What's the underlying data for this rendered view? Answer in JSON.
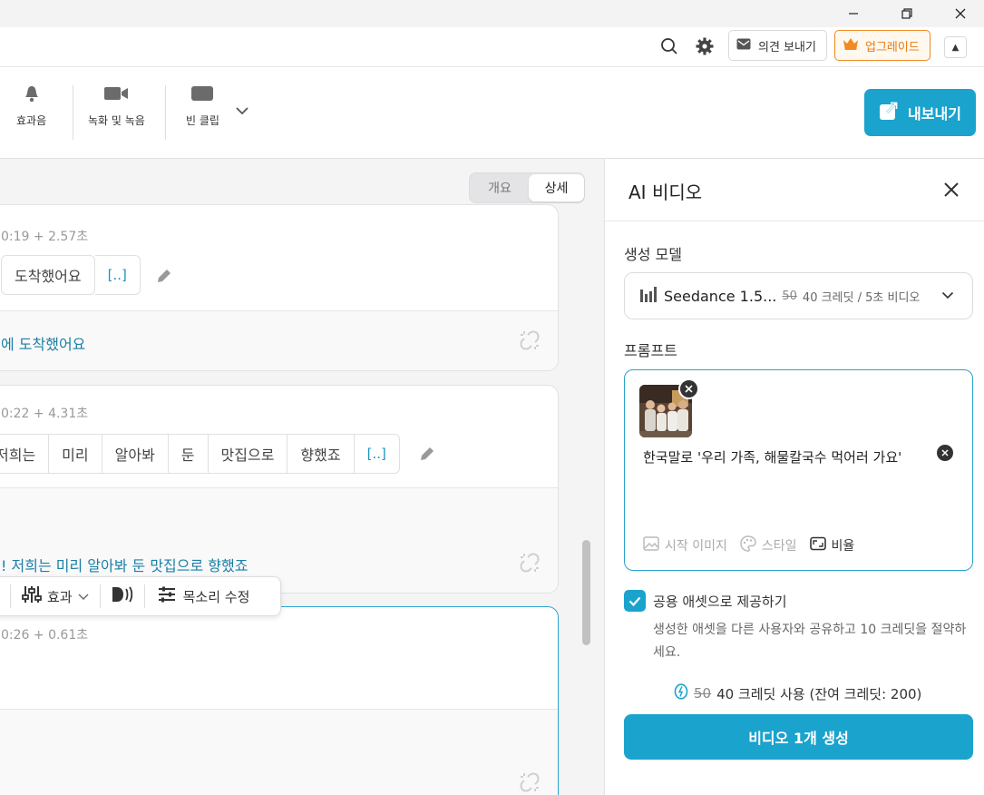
{
  "window": {
    "minimize": "—",
    "maximize": "❐",
    "close": "✕"
  },
  "header": {
    "feedback_label": "의견 보내기",
    "upgrade_label": "업그레이드"
  },
  "toolbar": {
    "tools": [
      {
        "label": "효과음",
        "icon": "bell-icon"
      },
      {
        "label": "녹화 및 녹음",
        "icon": "video-camera-icon"
      },
      {
        "label": "빈 클립",
        "icon": "blank-clip-icon"
      }
    ],
    "export_label": "내보내기"
  },
  "view_toggle": {
    "overview": "개요",
    "detail": "상세"
  },
  "cards": [
    {
      "time": "0:19 + 2.57초",
      "words": [
        "도착했어요"
      ],
      "more": "[..]",
      "subtitle": "에 도착했어요"
    },
    {
      "time": "0:22 + 4.31초",
      "words": [
        "저희는",
        "미리",
        "알아봐",
        "둔",
        "맛집으로",
        "향했죠"
      ],
      "more": "[..]",
      "subtitle": "! 저희는 미리 알아봐 둔 맛집으로 향했죠"
    },
    {
      "time": "0:26 + 0.61초"
    }
  ],
  "float_bar": {
    "effect_label": "효과",
    "voice_label": "목소리 수정"
  },
  "panel": {
    "title": "AI 비디오",
    "model_label": "생성 모델",
    "model": {
      "name": "Seedance 1.5...",
      "old_price": "50",
      "credit_text": "40 크레딧 / 5초 비디오"
    },
    "prompt_label": "프롬프트",
    "prompt_text": "한국말로 '우리 가족, 해물칼국수 먹어러 가요'",
    "prompt_tools": {
      "start_image": "시작 이미지",
      "style": "스타일",
      "ratio": "비율"
    },
    "share": {
      "checked": true,
      "label": "공용 애셋으로 제공하기",
      "description": "생성한 애셋을 다른 사용자와 공유하고 10 크레딧을 절약하세요."
    },
    "credit_use": {
      "old": "50",
      "text": "40 크레딧 사용 (잔여 크레딧: 200)"
    },
    "generate_label": "비디오 1개 생성"
  },
  "colors": {
    "accent": "#1aa3cd",
    "upgrade": "#e87a10",
    "subtitle": "#1a7fa6"
  }
}
